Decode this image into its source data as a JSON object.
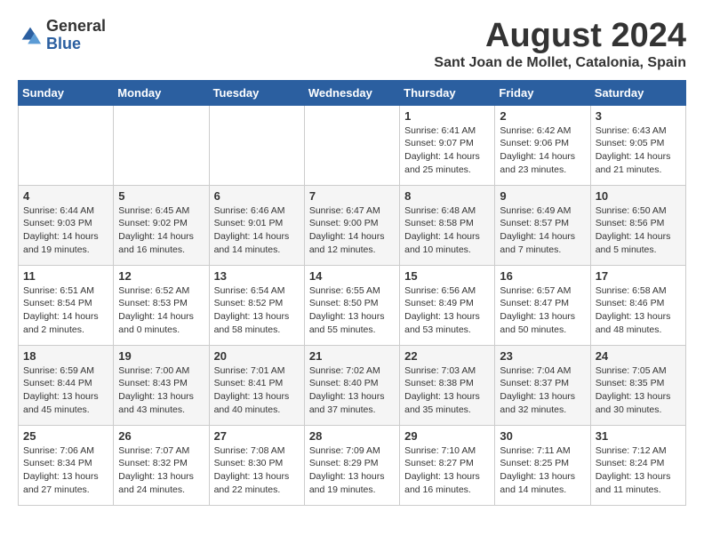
{
  "logo": {
    "general": "General",
    "blue": "Blue"
  },
  "title": "August 2024",
  "location": "Sant Joan de Mollet, Catalonia, Spain",
  "days_of_week": [
    "Sunday",
    "Monday",
    "Tuesday",
    "Wednesday",
    "Thursday",
    "Friday",
    "Saturday"
  ],
  "weeks": [
    [
      {
        "day": "",
        "content": ""
      },
      {
        "day": "",
        "content": ""
      },
      {
        "day": "",
        "content": ""
      },
      {
        "day": "",
        "content": ""
      },
      {
        "day": "1",
        "content": "Sunrise: 6:41 AM\nSunset: 9:07 PM\nDaylight: 14 hours\nand 25 minutes."
      },
      {
        "day": "2",
        "content": "Sunrise: 6:42 AM\nSunset: 9:06 PM\nDaylight: 14 hours\nand 23 minutes."
      },
      {
        "day": "3",
        "content": "Sunrise: 6:43 AM\nSunset: 9:05 PM\nDaylight: 14 hours\nand 21 minutes."
      }
    ],
    [
      {
        "day": "4",
        "content": "Sunrise: 6:44 AM\nSunset: 9:03 PM\nDaylight: 14 hours\nand 19 minutes."
      },
      {
        "day": "5",
        "content": "Sunrise: 6:45 AM\nSunset: 9:02 PM\nDaylight: 14 hours\nand 16 minutes."
      },
      {
        "day": "6",
        "content": "Sunrise: 6:46 AM\nSunset: 9:01 PM\nDaylight: 14 hours\nand 14 minutes."
      },
      {
        "day": "7",
        "content": "Sunrise: 6:47 AM\nSunset: 9:00 PM\nDaylight: 14 hours\nand 12 minutes."
      },
      {
        "day": "8",
        "content": "Sunrise: 6:48 AM\nSunset: 8:58 PM\nDaylight: 14 hours\nand 10 minutes."
      },
      {
        "day": "9",
        "content": "Sunrise: 6:49 AM\nSunset: 8:57 PM\nDaylight: 14 hours\nand 7 minutes."
      },
      {
        "day": "10",
        "content": "Sunrise: 6:50 AM\nSunset: 8:56 PM\nDaylight: 14 hours\nand 5 minutes."
      }
    ],
    [
      {
        "day": "11",
        "content": "Sunrise: 6:51 AM\nSunset: 8:54 PM\nDaylight: 14 hours\nand 2 minutes."
      },
      {
        "day": "12",
        "content": "Sunrise: 6:52 AM\nSunset: 8:53 PM\nDaylight: 14 hours\nand 0 minutes."
      },
      {
        "day": "13",
        "content": "Sunrise: 6:54 AM\nSunset: 8:52 PM\nDaylight: 13 hours\nand 58 minutes."
      },
      {
        "day": "14",
        "content": "Sunrise: 6:55 AM\nSunset: 8:50 PM\nDaylight: 13 hours\nand 55 minutes."
      },
      {
        "day": "15",
        "content": "Sunrise: 6:56 AM\nSunset: 8:49 PM\nDaylight: 13 hours\nand 53 minutes."
      },
      {
        "day": "16",
        "content": "Sunrise: 6:57 AM\nSunset: 8:47 PM\nDaylight: 13 hours\nand 50 minutes."
      },
      {
        "day": "17",
        "content": "Sunrise: 6:58 AM\nSunset: 8:46 PM\nDaylight: 13 hours\nand 48 minutes."
      }
    ],
    [
      {
        "day": "18",
        "content": "Sunrise: 6:59 AM\nSunset: 8:44 PM\nDaylight: 13 hours\nand 45 minutes."
      },
      {
        "day": "19",
        "content": "Sunrise: 7:00 AM\nSunset: 8:43 PM\nDaylight: 13 hours\nand 43 minutes."
      },
      {
        "day": "20",
        "content": "Sunrise: 7:01 AM\nSunset: 8:41 PM\nDaylight: 13 hours\nand 40 minutes."
      },
      {
        "day": "21",
        "content": "Sunrise: 7:02 AM\nSunset: 8:40 PM\nDaylight: 13 hours\nand 37 minutes."
      },
      {
        "day": "22",
        "content": "Sunrise: 7:03 AM\nSunset: 8:38 PM\nDaylight: 13 hours\nand 35 minutes."
      },
      {
        "day": "23",
        "content": "Sunrise: 7:04 AM\nSunset: 8:37 PM\nDaylight: 13 hours\nand 32 minutes."
      },
      {
        "day": "24",
        "content": "Sunrise: 7:05 AM\nSunset: 8:35 PM\nDaylight: 13 hours\nand 30 minutes."
      }
    ],
    [
      {
        "day": "25",
        "content": "Sunrise: 7:06 AM\nSunset: 8:34 PM\nDaylight: 13 hours\nand 27 minutes."
      },
      {
        "day": "26",
        "content": "Sunrise: 7:07 AM\nSunset: 8:32 PM\nDaylight: 13 hours\nand 24 minutes."
      },
      {
        "day": "27",
        "content": "Sunrise: 7:08 AM\nSunset: 8:30 PM\nDaylight: 13 hours\nand 22 minutes."
      },
      {
        "day": "28",
        "content": "Sunrise: 7:09 AM\nSunset: 8:29 PM\nDaylight: 13 hours\nand 19 minutes."
      },
      {
        "day": "29",
        "content": "Sunrise: 7:10 AM\nSunset: 8:27 PM\nDaylight: 13 hours\nand 16 minutes."
      },
      {
        "day": "30",
        "content": "Sunrise: 7:11 AM\nSunset: 8:25 PM\nDaylight: 13 hours\nand 14 minutes."
      },
      {
        "day": "31",
        "content": "Sunrise: 7:12 AM\nSunset: 8:24 PM\nDaylight: 13 hours\nand 11 minutes."
      }
    ]
  ]
}
